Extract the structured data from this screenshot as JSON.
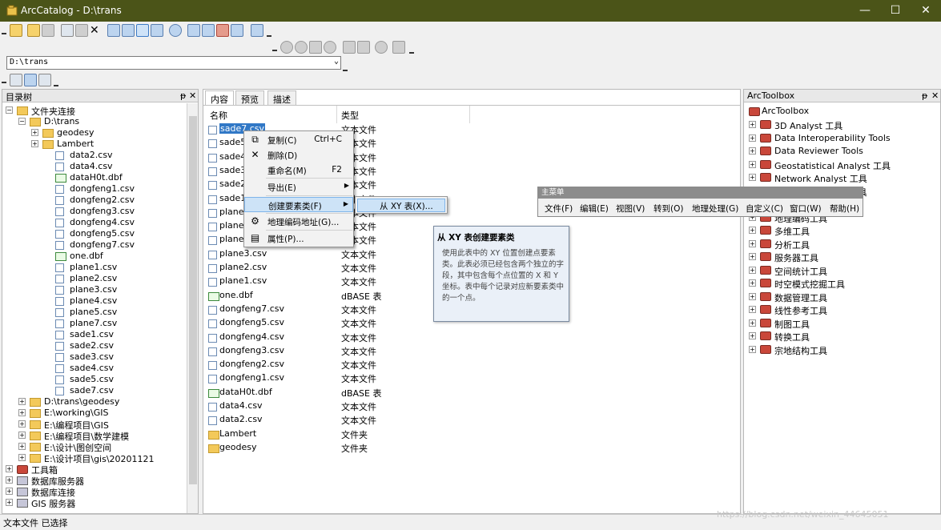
{
  "window": {
    "title": "ArcCatalog - D:\\trans",
    "min": "—",
    "max": "☐",
    "close": "✕"
  },
  "location": {
    "path": "D:\\trans"
  },
  "catalog_tree": {
    "title": "目录树",
    "pin": "ᵽ",
    "close": "✕",
    "items": [
      {
        "label": "文件夹连接",
        "depth": 0,
        "expander": "⊟",
        "icon": "folder"
      },
      {
        "label": "D:\\trans",
        "depth": 1,
        "expander": "⊟",
        "icon": "folder"
      },
      {
        "label": "geodesy",
        "depth": 2,
        "expander": "⊞",
        "icon": "folder"
      },
      {
        "label": "Lambert",
        "depth": 2,
        "expander": "⊞",
        "icon": "folder"
      },
      {
        "label": "data2.csv",
        "depth": 3,
        "expander": "",
        "icon": "file"
      },
      {
        "label": "data4.csv",
        "depth": 3,
        "expander": "",
        "icon": "file"
      },
      {
        "label": "dataH0t.dbf",
        "depth": 3,
        "expander": "",
        "icon": "dbf"
      },
      {
        "label": "dongfeng1.csv",
        "depth": 3,
        "expander": "",
        "icon": "file"
      },
      {
        "label": "dongfeng2.csv",
        "depth": 3,
        "expander": "",
        "icon": "file"
      },
      {
        "label": "dongfeng3.csv",
        "depth": 3,
        "expander": "",
        "icon": "file"
      },
      {
        "label": "dongfeng4.csv",
        "depth": 3,
        "expander": "",
        "icon": "file"
      },
      {
        "label": "dongfeng5.csv",
        "depth": 3,
        "expander": "",
        "icon": "file"
      },
      {
        "label": "dongfeng7.csv",
        "depth": 3,
        "expander": "",
        "icon": "file"
      },
      {
        "label": "one.dbf",
        "depth": 3,
        "expander": "",
        "icon": "dbf"
      },
      {
        "label": "plane1.csv",
        "depth": 3,
        "expander": "",
        "icon": "file"
      },
      {
        "label": "plane2.csv",
        "depth": 3,
        "expander": "",
        "icon": "file"
      },
      {
        "label": "plane3.csv",
        "depth": 3,
        "expander": "",
        "icon": "file"
      },
      {
        "label": "plane4.csv",
        "depth": 3,
        "expander": "",
        "icon": "file"
      },
      {
        "label": "plane5.csv",
        "depth": 3,
        "expander": "",
        "icon": "file"
      },
      {
        "label": "plane7.csv",
        "depth": 3,
        "expander": "",
        "icon": "file"
      },
      {
        "label": "sade1.csv",
        "depth": 3,
        "expander": "",
        "icon": "file"
      },
      {
        "label": "sade2.csv",
        "depth": 3,
        "expander": "",
        "icon": "file"
      },
      {
        "label": "sade3.csv",
        "depth": 3,
        "expander": "",
        "icon": "file"
      },
      {
        "label": "sade4.csv",
        "depth": 3,
        "expander": "",
        "icon": "file"
      },
      {
        "label": "sade5.csv",
        "depth": 3,
        "expander": "",
        "icon": "file"
      },
      {
        "label": "sade7.csv",
        "depth": 3,
        "expander": "",
        "icon": "file"
      },
      {
        "label": "D:\\trans\\geodesy",
        "depth": 1,
        "expander": "⊞",
        "icon": "folder"
      },
      {
        "label": "E:\\working\\GIS",
        "depth": 1,
        "expander": "⊞",
        "icon": "folder"
      },
      {
        "label": "E:\\编程项目\\GIS",
        "depth": 1,
        "expander": "⊞",
        "icon": "folder"
      },
      {
        "label": "E:\\编程项目\\数学建模",
        "depth": 1,
        "expander": "⊞",
        "icon": "folder"
      },
      {
        "label": "E:\\设计\\图创空间",
        "depth": 1,
        "expander": "⊞",
        "icon": "folder"
      },
      {
        "label": "E:\\设计项目\\gis\\20201121",
        "depth": 1,
        "expander": "⊞",
        "icon": "folder"
      },
      {
        "label": "工具箱",
        "depth": 0,
        "expander": "⊞",
        "icon": "tool"
      },
      {
        "label": "数据库服务器",
        "depth": 0,
        "expander": "⊞",
        "icon": "db"
      },
      {
        "label": "数据库连接",
        "depth": 0,
        "expander": "⊞",
        "icon": "db"
      },
      {
        "label": "GIS 服务器",
        "depth": 0,
        "expander": "⊞",
        "icon": "db"
      }
    ]
  },
  "contents": {
    "tabs": [
      "内容",
      "预览",
      "描述"
    ],
    "columns": {
      "name": "名称",
      "type": "类型"
    },
    "rows": [
      {
        "name": "sade7.csv",
        "type": "文本文件",
        "icon": "file",
        "selected": true
      },
      {
        "name": "sade5",
        "type": "文本文件",
        "icon": "file"
      },
      {
        "name": "sade4",
        "type": "文本文件",
        "icon": "file"
      },
      {
        "name": "sade3",
        "type": "文本文件",
        "icon": "file"
      },
      {
        "name": "sade2",
        "type": "文本文件",
        "icon": "file"
      },
      {
        "name": "sade1",
        "type": "文本文件",
        "icon": "file"
      },
      {
        "name": "plane7",
        "type": "文本文件",
        "icon": "file"
      },
      {
        "name": "plane5",
        "type": "文本文件",
        "icon": "file"
      },
      {
        "name": "plane4",
        "type": "文本文件",
        "icon": "file"
      },
      {
        "name": "plane3.csv",
        "type": "文本文件",
        "icon": "file"
      },
      {
        "name": "plane2.csv",
        "type": "文本文件",
        "icon": "file"
      },
      {
        "name": "plane1.csv",
        "type": "文本文件",
        "icon": "file"
      },
      {
        "name": "one.dbf",
        "type": "dBASE 表",
        "icon": "dbf"
      },
      {
        "name": "dongfeng7.csv",
        "type": "文本文件",
        "icon": "file"
      },
      {
        "name": "dongfeng5.csv",
        "type": "文本文件",
        "icon": "file"
      },
      {
        "name": "dongfeng4.csv",
        "type": "文本文件",
        "icon": "file"
      },
      {
        "name": "dongfeng3.csv",
        "type": "文本文件",
        "icon": "file"
      },
      {
        "name": "dongfeng2.csv",
        "type": "文本文件",
        "icon": "file"
      },
      {
        "name": "dongfeng1.csv",
        "type": "文本文件",
        "icon": "file"
      },
      {
        "name": "dataH0t.dbf",
        "type": "dBASE 表",
        "icon": "dbf"
      },
      {
        "name": "data4.csv",
        "type": "文本文件",
        "icon": "file"
      },
      {
        "name": "data2.csv",
        "type": "文本文件",
        "icon": "file"
      },
      {
        "name": "Lambert",
        "type": "文件夹",
        "icon": "folder"
      },
      {
        "name": "geodesy",
        "type": "文件夹",
        "icon": "folder"
      }
    ]
  },
  "context_menu": {
    "items": [
      {
        "label": "复制(C)",
        "shortcut": "Ctrl+C",
        "icon": "copy-icon",
        "glyph": "⧉"
      },
      {
        "label": "删除(D)",
        "shortcut": "",
        "icon": "delete-icon",
        "glyph": "✕"
      },
      {
        "label": "重命名(M)",
        "shortcut": "F2",
        "icon": "",
        "glyph": ""
      },
      {
        "label": "导出(E)",
        "shortcut": "",
        "icon": "",
        "glyph": "",
        "submenu": true
      },
      {
        "label": "创建要素类(F)",
        "shortcut": "",
        "icon": "",
        "glyph": "",
        "submenu": true,
        "highlighted": true
      },
      {
        "label": "地理编码地址(G)...",
        "shortcut": "",
        "icon": "geocode-icon",
        "glyph": "⚙"
      },
      {
        "label": "属性(P)...",
        "shortcut": "",
        "icon": "properties-icon",
        "glyph": "▤"
      }
    ],
    "arrow": "▶"
  },
  "submenu": {
    "item": "从 XY 表(X)..."
  },
  "tooltip": {
    "title": "从 XY 表创建要素类",
    "body": "使用此表中的 XY 位置创建点要素类。此表必须已经包含两个独立的字段，其中包含每个点位置的 X 和 Y 坐标。表中每个记录对应新要素类中的一个点。"
  },
  "main_menu": {
    "title": "主菜单",
    "items": [
      "文件(F)",
      "编辑(E)",
      "视图(V)",
      "转到(O)",
      "地理处理(G)",
      "自定义(C)",
      "窗口(W)",
      "帮助(H)"
    ]
  },
  "toolbox": {
    "title": "ArcToolbox",
    "root": "ArcToolbox",
    "items": [
      "3D Analyst 工具",
      "Data Interoperability Tools",
      "Data Reviewer Tools",
      "Geostatistical Analyst 工具",
      "Network Analyst 工具",
      "Tracking Analyst 工具",
      "编辑工具",
      "地理编码工具",
      "多维工具",
      "分析工具",
      "服务器工具",
      "空间统计工具",
      "时空模式挖掘工具",
      "数据管理工具",
      "线性参考工具",
      "制图工具",
      "转换工具",
      "宗地结构工具"
    ]
  },
  "status": {
    "text": "文本文件 已选择"
  },
  "watermark": "https://blog.csdn.net/weixin_44645051"
}
